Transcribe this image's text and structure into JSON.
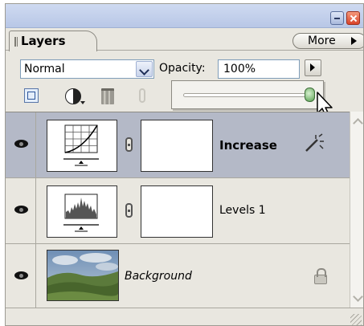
{
  "panel": {
    "tab_label": "Layers",
    "more_label": "More"
  },
  "controls": {
    "blend_mode": "Normal",
    "opacity_label": "Opacity:",
    "opacity_value": "100%",
    "opacity_slider_fraction": 0.97
  },
  "layers": [
    {
      "name": "Increase",
      "selected": true,
      "type": "curves-adjustment",
      "icon": "magic-wand-icon"
    },
    {
      "name": "Levels 1",
      "selected": false,
      "type": "levels-adjustment"
    },
    {
      "name": "Background",
      "selected": false,
      "type": "image",
      "icon": "lock-icon"
    }
  ],
  "colors": {
    "panel_bg": "#e9e7e0",
    "selected_row": "#b4b9c7",
    "title_bar": "#c4d1ec",
    "close_button": "#d9432a"
  }
}
